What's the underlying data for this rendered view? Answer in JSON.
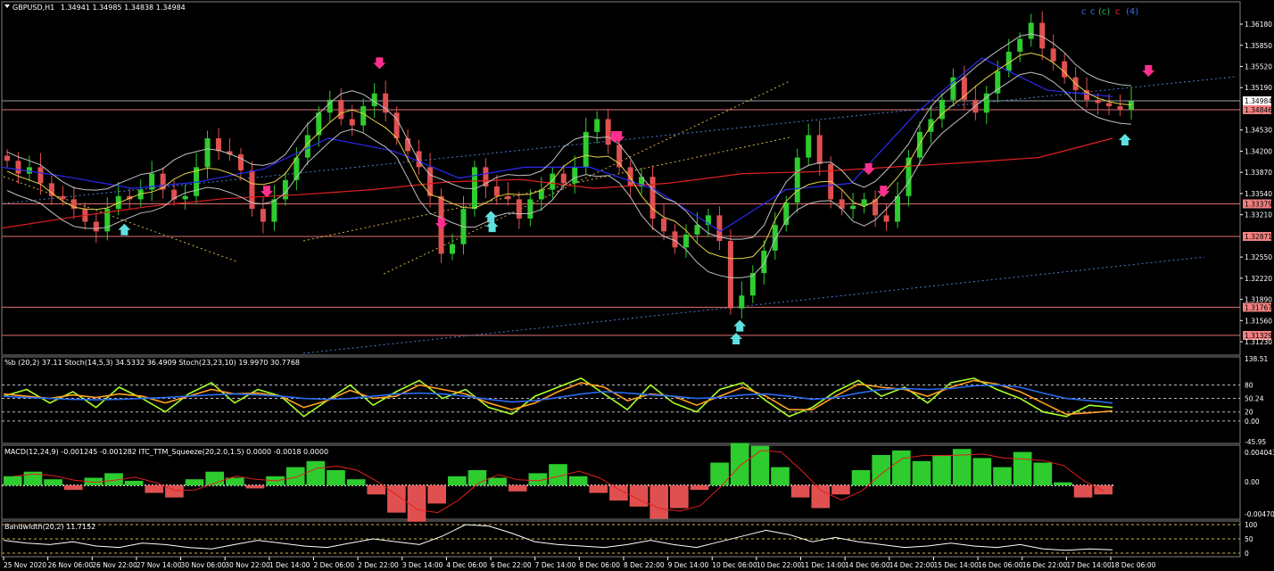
{
  "chart_data": [
    {
      "panel": "price",
      "type": "candlestick",
      "symbol_label": "GBPUSD,H1",
      "ohlc_label": "1.34941 1.34985 1.34838 1.34984",
      "top_right_labels": [
        {
          "text": "c",
          "color": "#3a6ff0"
        },
        {
          "text": "c",
          "color": "#3a6ff0"
        },
        {
          "text": "(c)",
          "color": "#2fb84a"
        },
        {
          "text": "c",
          "color": "#e03030"
        },
        {
          "text": "(4)",
          "color": "#3a6ff0"
        }
      ],
      "ylim": [
        1.3105,
        1.365
      ],
      "y_ticks": [
        "1.36180",
        "1.35850",
        "1.35520",
        "1.35190",
        "1.34530",
        "1.34200",
        "1.33870",
        "1.33540",
        "1.33210",
        "1.32550",
        "1.32220",
        "1.31890",
        "1.31560",
        "1.31230"
      ],
      "price_tags": [
        {
          "text": "1.34984",
          "value": 1.34984,
          "bg": "#ffffff",
          "fg": "#000000"
        },
        {
          "text": "1.34846",
          "value": 1.34846,
          "bg": "#f08080",
          "fg": "#000000"
        },
        {
          "text": "1.33379",
          "value": 1.33379,
          "bg": "#f08080",
          "fg": "#000000"
        },
        {
          "text": "1.32871",
          "value": 1.32871,
          "bg": "#f08080",
          "fg": "#000000"
        },
        {
          "text": "1.31767",
          "value": 1.31767,
          "bg": "#f08080",
          "fg": "#000000"
        },
        {
          "text": "1.31329",
          "value": 1.31329,
          "bg": "#f08080",
          "fg": "#000000"
        }
      ],
      "closes": [
        1.3405,
        1.3385,
        1.3395,
        1.337,
        1.335,
        1.3345,
        1.333,
        1.331,
        1.3295,
        1.333,
        1.335,
        1.3345,
        1.336,
        1.3385,
        1.336,
        1.3345,
        1.335,
        1.3395,
        1.344,
        1.342,
        1.3415,
        1.339,
        1.333,
        1.331,
        1.3345,
        1.3375,
        1.341,
        1.3445,
        1.348,
        1.35,
        1.347,
        1.346,
        1.349,
        1.351,
        1.348,
        1.344,
        1.342,
        1.3395,
        1.335,
        1.326,
        1.3275,
        1.333,
        1.3395,
        1.3365,
        1.335,
        1.3345,
        1.3315,
        1.3345,
        1.336,
        1.3385,
        1.337,
        1.3395,
        1.345,
        1.347,
        1.343,
        1.3395,
        1.3365,
        1.338,
        1.3315,
        1.3295,
        1.327,
        1.329,
        1.3305,
        1.332,
        1.328,
        1.3175,
        1.3195,
        1.323,
        1.3265,
        1.3305,
        1.334,
        1.341,
        1.3445,
        1.34,
        1.3345,
        1.333,
        1.3335,
        1.3345,
        1.332,
        1.331,
        1.335,
        1.341,
        1.345,
        1.347,
        1.35,
        1.3535,
        1.35,
        1.348,
        1.351,
        1.3545,
        1.3575,
        1.3595,
        1.362,
        1.358,
        1.356,
        1.3535,
        1.3515,
        1.35,
        1.3495,
        1.349,
        1.3485,
        1.3498
      ],
      "moving_averages": [
        {
          "color": "#e02020",
          "values": [
            1.33,
            1.3318,
            1.3334,
            1.3346,
            1.3352,
            1.336,
            1.3372,
            1.3376,
            1.3362,
            1.337,
            1.3385,
            1.3388,
            1.3395,
            1.3402,
            1.341,
            1.344
          ]
        },
        {
          "color": "#2a2af0",
          "values": [
            1.3395,
            1.338,
            1.3362,
            1.3372,
            1.3392,
            1.344,
            1.342,
            1.3378,
            1.3395,
            1.3395,
            1.336,
            1.3295,
            1.336,
            1.337,
            1.348,
            1.3565,
            1.3515,
            1.3505
          ]
        }
      ],
      "arrows_down": [
        0.214,
        0.305,
        0.355,
        0.495,
        0.498,
        0.712,
        0.7,
        0.926
      ],
      "arrows_up": [
        0.099,
        0.395,
        0.396,
        0.593,
        0.596,
        0.907
      ]
    },
    {
      "panel": "oscillator",
      "type": "line",
      "label": "%b (20,2) 37.11  Stoch(14,5,3) 34.5332 36.4909  Stoch(23,23,10) 19.9970 30.7768",
      "y_ticks": [
        "138.51",
        "80",
        "50.24",
        "20",
        "0.00",
        "-45.95"
      ],
      "series": [
        {
          "color": "#a8ff28",
          "values": [
            55,
            70,
            40,
            65,
            30,
            75,
            50,
            20,
            60,
            85,
            40,
            70,
            55,
            10,
            45,
            80,
            35,
            65,
            90,
            50,
            70,
            30,
            15,
            55,
            75,
            95,
            60,
            25,
            80,
            40,
            20,
            70,
            85,
            45,
            10,
            30,
            65,
            90,
            55,
            75,
            40,
            85,
            95,
            70,
            50,
            20,
            10,
            35,
            30
          ]
        },
        {
          "color": "#ffa020",
          "values": [
            60,
            55,
            50,
            58,
            52,
            60,
            55,
            40,
            55,
            70,
            60,
            62,
            55,
            30,
            45,
            68,
            50,
            55,
            80,
            70,
            60,
            40,
            25,
            40,
            65,
            85,
            75,
            45,
            60,
            55,
            35,
            55,
            75,
            55,
            25,
            25,
            55,
            82,
            75,
            70,
            55,
            75,
            90,
            82,
            65,
            40,
            15,
            18,
            22
          ]
        },
        {
          "color": "#2a6af0",
          "values": [
            55,
            52,
            50,
            48,
            47,
            48,
            50,
            52,
            55,
            58,
            60,
            58,
            55,
            50,
            48,
            50,
            55,
            60,
            62,
            60,
            55,
            48,
            42,
            45,
            52,
            60,
            65,
            62,
            58,
            55,
            50,
            52,
            58,
            60,
            55,
            48,
            52,
            62,
            70,
            72,
            70,
            72,
            78,
            80,
            75,
            62,
            50,
            45,
            40
          ]
        }
      ]
    },
    {
      "panel": "macd",
      "type": "histogram",
      "label": "MACD(12,24,9) -0.001245 -0.001282  ITC_TTM_Squeeze(20,2.0,1.5) 0.0000 -0.0018 0.0000",
      "y_ticks": [
        "0.004043",
        "0.00",
        "-0.004703"
      ],
      "values": [
        0.6,
        0.9,
        0.4,
        -0.3,
        0.5,
        0.8,
        0.3,
        -0.5,
        -0.8,
        0.4,
        0.9,
        0.5,
        -0.2,
        0.6,
        1.2,
        1.6,
        1.0,
        0.4,
        -0.6,
        -1.8,
        -2.4,
        -1.2,
        0.6,
        1.0,
        0.5,
        -0.4,
        0.8,
        1.4,
        0.6,
        -0.5,
        -1.0,
        -1.4,
        -2.2,
        -1.5,
        -0.3,
        1.5,
        2.8,
        2.6,
        1.2,
        -0.8,
        -1.5,
        -0.6,
        1.0,
        2.0,
        2.3,
        1.6,
        2.0,
        2.4,
        1.8,
        1.2,
        2.2,
        1.5,
        0.2,
        -0.8,
        -0.6
      ]
    },
    {
      "panel": "bandwidth",
      "type": "line",
      "label": "Bandwidth(20,2) 11.7152",
      "y_ticks": [
        "100",
        "50",
        "0"
      ],
      "values": [
        45,
        35,
        30,
        40,
        25,
        20,
        35,
        30,
        20,
        15,
        30,
        45,
        35,
        25,
        20,
        35,
        50,
        40,
        30,
        60,
        100,
        95,
        70,
        40,
        30,
        25,
        20,
        30,
        45,
        30,
        20,
        40,
        60,
        80,
        65,
        40,
        55,
        40,
        30,
        20,
        25,
        35,
        25,
        20,
        30,
        15,
        10,
        15,
        12
      ]
    }
  ],
  "x_axis": {
    "labels": [
      "25 Nov 2020",
      "26 Nov 06:00",
      "26 Nov 22:00",
      "27 Nov 14:00",
      "30 Nov 06:00",
      "30 Nov 22:00",
      "1 Dec 14:00",
      "2 Dec 06:00",
      "2 Dec 22:00",
      "3 Dec 14:00",
      "4 Dec 06:00",
      "6 Dec 22:00",
      "7 Dec 14:00",
      "8 Dec 06:00",
      "8 Dec 22:00",
      "9 Dec 14:00",
      "10 Dec 06:00",
      "10 Dec 22:00",
      "11 Dec 14:00",
      "14 Dec 06:00",
      "14 Dec 22:00",
      "15 Dec 14:00",
      "16 Dec 06:00",
      "16 Dec 22:00",
      "17 Dec 14:00",
      "18 Dec 06:00"
    ]
  },
  "colors": {
    "bull": "#2ecc2e",
    "bear": "#e05050",
    "hline": "#e07070",
    "axis": "#ffffff"
  }
}
